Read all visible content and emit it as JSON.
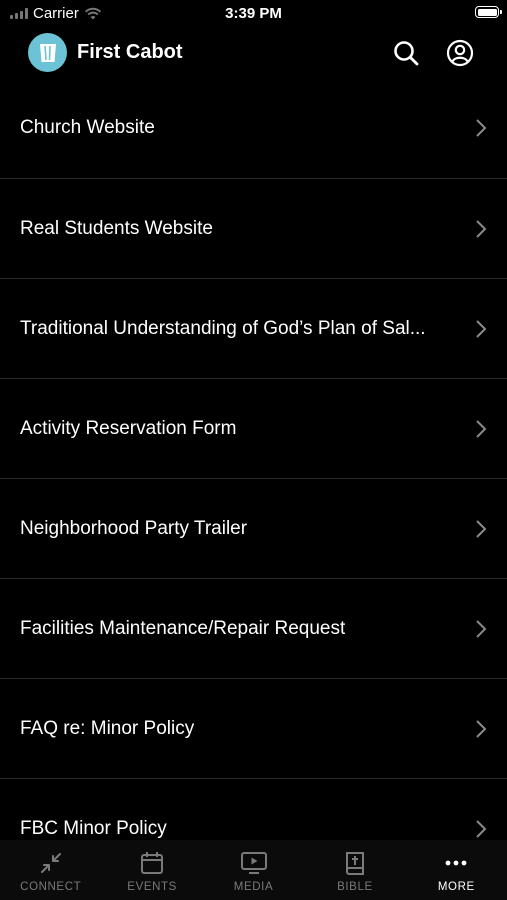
{
  "status_bar": {
    "carrier": "Carrier",
    "time": "3:39 PM"
  },
  "header": {
    "title": "First Cabot",
    "logo_color": "#6cc3d5",
    "search_icon": "search-icon",
    "profile_icon": "user-circle-icon"
  },
  "menu": {
    "items": [
      {
        "label": "Church Website"
      },
      {
        "label": "Real Students Website"
      },
      {
        "label": "Traditional Understanding of God’s Plan of Sal..."
      },
      {
        "label": "Activity Reservation Form"
      },
      {
        "label": "Neighborhood Party Trailer"
      },
      {
        "label": "Facilities Maintenance/Repair Request"
      },
      {
        "label": "FAQ re: Minor Policy"
      },
      {
        "label": "FBC Minor Policy"
      }
    ]
  },
  "tab_bar": {
    "tabs": [
      {
        "label": "CONNECT",
        "icon": "connect-arrows-icon"
      },
      {
        "label": "EVENTS",
        "icon": "calendar-icon"
      },
      {
        "label": "MEDIA",
        "icon": "tv-play-icon"
      },
      {
        "label": "BIBLE",
        "icon": "bible-icon"
      },
      {
        "label": "MORE",
        "icon": "more-dots-icon",
        "active": true
      }
    ],
    "inactive_color": "#7a7a7a",
    "active_color": "#ffffff"
  }
}
